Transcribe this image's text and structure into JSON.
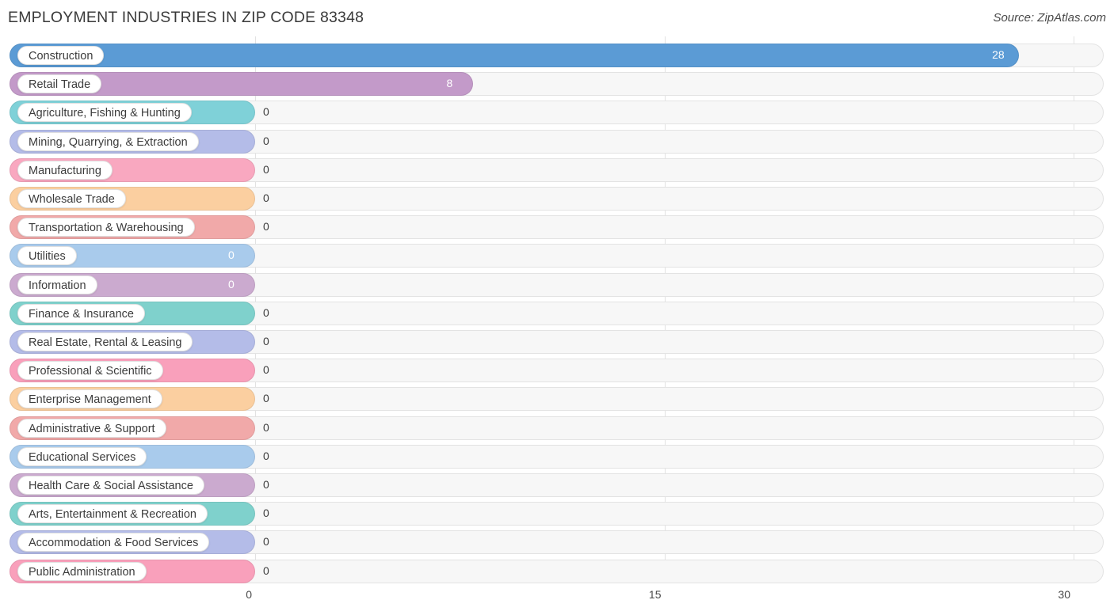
{
  "header": {
    "title": "EMPLOYMENT INDUSTRIES IN ZIP CODE 83348",
    "source": "Source: ZipAtlas.com"
  },
  "chart_data": {
    "type": "bar",
    "orientation": "horizontal",
    "title": "EMPLOYMENT INDUSTRIES IN ZIP CODE 83348",
    "xlabel": "",
    "ylabel": "",
    "xlim": [
      0,
      30
    ],
    "ticks": [
      "0",
      "15",
      "30"
    ],
    "tick_values": [
      0,
      15,
      30
    ],
    "grid": true,
    "legend": "none",
    "categories": [
      "Construction",
      "Retail Trade",
      "Agriculture, Fishing & Hunting",
      "Mining, Quarrying, & Extraction",
      "Manufacturing",
      "Wholesale Trade",
      "Transportation & Warehousing",
      "Utilities",
      "Information",
      "Finance & Insurance",
      "Real Estate, Rental & Leasing",
      "Professional & Scientific",
      "Enterprise Management",
      "Administrative & Support",
      "Educational Services",
      "Health Care & Social Assistance",
      "Arts, Entertainment & Recreation",
      "Accommodation & Food Services",
      "Public Administration"
    ],
    "values": [
      28,
      8,
      0,
      0,
      0,
      0,
      0,
      0,
      0,
      0,
      0,
      0,
      0,
      0,
      0,
      0,
      0,
      0,
      0
    ],
    "value_labels": [
      "28",
      "8",
      "0",
      "0",
      "0",
      "0",
      "0",
      "0",
      "0",
      "0",
      "0",
      "0",
      "0",
      "0",
      "0",
      "0",
      "0",
      "0",
      "0"
    ],
    "colors": [
      "#5b9bd5",
      "#c39ac9",
      "#7fd1d8",
      "#b4bce8",
      "#f9a8c0",
      "#fbcfa0",
      "#f1a9a9",
      "#a9cbec",
      "#cbaacf",
      "#7fd1cc",
      "#b4bce8",
      "#f9a0bb",
      "#fbcfa0",
      "#f1a9a9",
      "#a9cbec",
      "#cbaacf",
      "#7fd1cc",
      "#b4bce8",
      "#f9a0bb"
    ]
  },
  "palette": {
    "track_fill": "#f7f7f7",
    "track_border": "#e3e3e3",
    "gridline": "#e2e2e2",
    "text": "#3c3c3c"
  }
}
